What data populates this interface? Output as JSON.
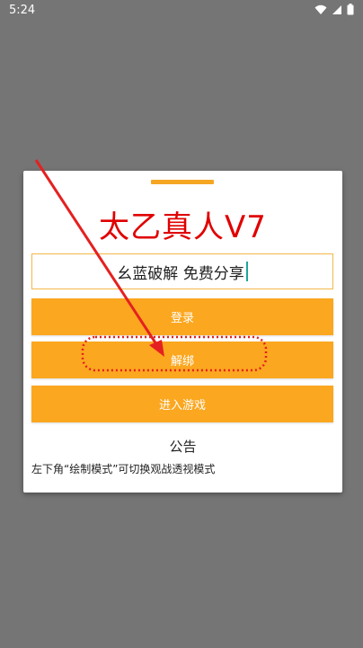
{
  "status_bar": {
    "time": "5:24",
    "icons": [
      "wifi-icon",
      "signal-icon",
      "battery-icon"
    ]
  },
  "dialog": {
    "title": "太乙真人V7",
    "input": {
      "value": "幺蓝破解 免费分享"
    },
    "buttons": {
      "login": "登录",
      "unbind": "解绑",
      "enter_game": "进入游戏"
    },
    "notice": {
      "title": "公告",
      "body": "左下角“绘制模式”可切换观战透视模式"
    }
  },
  "colors": {
    "accent": "#FBA71F",
    "title": "#E00000",
    "annotation": "#E52020",
    "overlay": "#757575"
  }
}
